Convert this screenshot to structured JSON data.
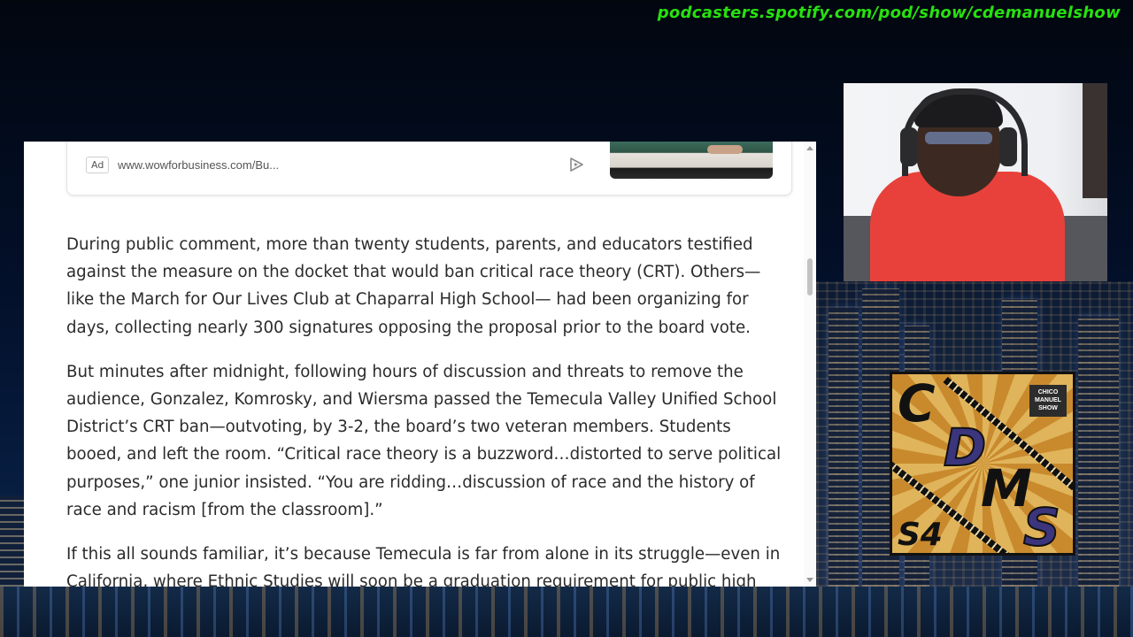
{
  "overlay": {
    "podcast_url": "podcasters.spotify.com/pod/show/cdemanuelshow"
  },
  "ad": {
    "badge": "Ad",
    "url": "www.wowforbusiness.com/Bu...",
    "play_icon": "play-icon"
  },
  "article": {
    "paragraphs": [
      "During public comment, more than twenty students, parents, and educators testified against the measure on the docket that would ban critical race theory (CRT). Others—like the March for Our Lives Club at Chaparral High School— had been organizing for days, collecting nearly 300 signatures opposing the proposal prior to the board vote.",
      "But minutes after midnight, following hours of discussion and threats to remove the audience, Gonzalez, Komrosky, and Wiersma passed the Temecula Valley Unified School District’s CRT ban—outvoting, by 3-2, the board’s two veteran members. Students booed, and left the room. “Critical race theory is a buzzword…distorted to serve political purposes,” one junior insisted. “You are ridding…discussion of race and the history of race and racism [from the classroom].”",
      "If this all sounds familiar, it’s because Temecula is far from alone in its struggle—even in California, where Ethnic Studies will soon be a graduation requirement for public high"
    ]
  },
  "logo": {
    "letters": [
      "C",
      "D",
      "M",
      "S"
    ],
    "season": "S4",
    "badge_text": "CHICO MANUEL SHOW"
  },
  "colors": {
    "url_green": "#27e10f",
    "logo_purple": "#3b357d",
    "logo_gold": "#e0b45a"
  }
}
